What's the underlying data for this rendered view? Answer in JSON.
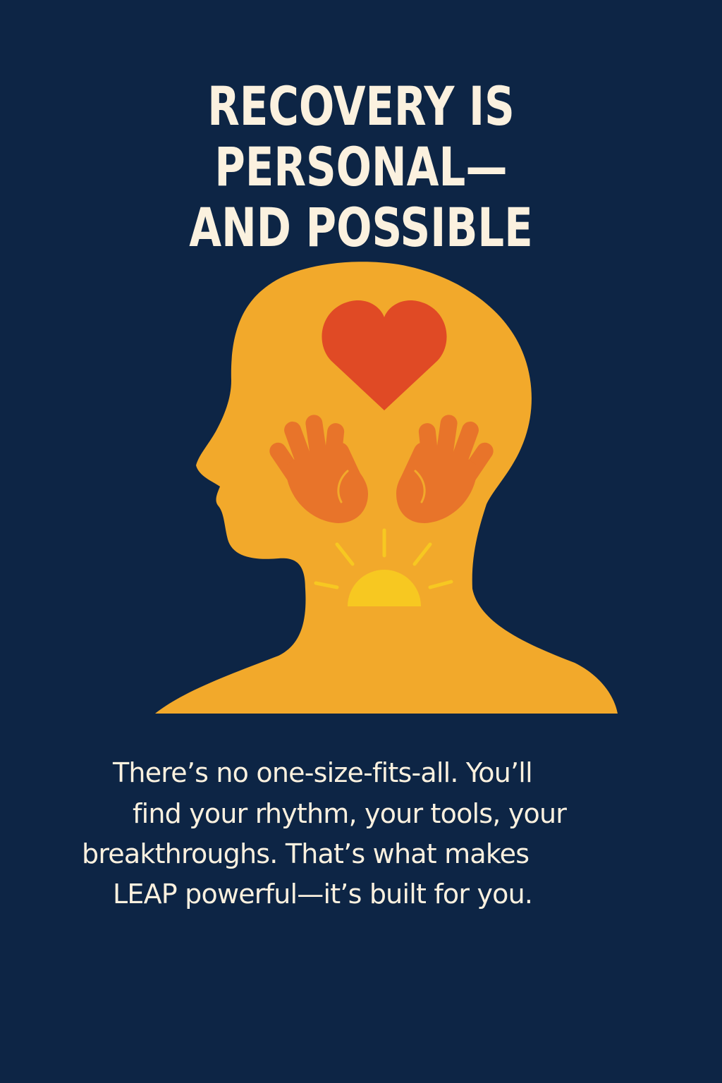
{
  "poster": {
    "headline": {
      "line1": "RECOVERY IS PERSONAL—",
      "line2": "AND POSSIBLE"
    },
    "illustration": {
      "head_icon": "head-silhouette-icon",
      "heart_icon": "heart-icon",
      "hands_icon": "open-hands-icon",
      "sun_icon": "rising-sun-icon"
    },
    "body": {
      "lines": [
        "There’s no one-size-fits-all. You’ll",
        "find your rhythm, your tools, your",
        "breakthroughs. That’s what makes",
        "LEAP powerful—it’s built for you."
      ]
    },
    "colors": {
      "background": "#0d2545",
      "text": "#fbf1df",
      "head": "#f2a92b",
      "heart": "#e04a25",
      "hands": "#e8742a",
      "sun": "#f7c821"
    }
  }
}
